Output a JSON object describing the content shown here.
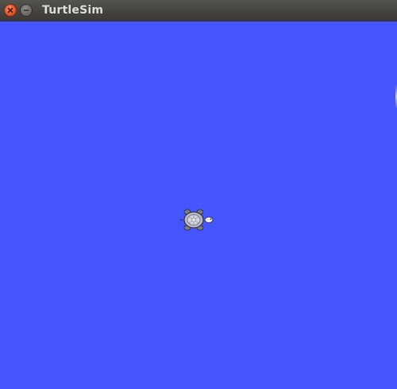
{
  "window": {
    "title": "TurtleSim"
  },
  "titlebar": {
    "buttons": [
      {
        "name": "close",
        "icon": "close-icon"
      },
      {
        "name": "minimize",
        "icon": "minimize-icon"
      }
    ]
  },
  "canvas": {
    "background_color": "#4556ff",
    "turtle_icon": "turtle-icon"
  },
  "colors": {
    "titlebar": "#45443f",
    "close_button": "#e95a2d",
    "minimize_button": "#6c6b66",
    "title_text": "#e0ddd6"
  }
}
